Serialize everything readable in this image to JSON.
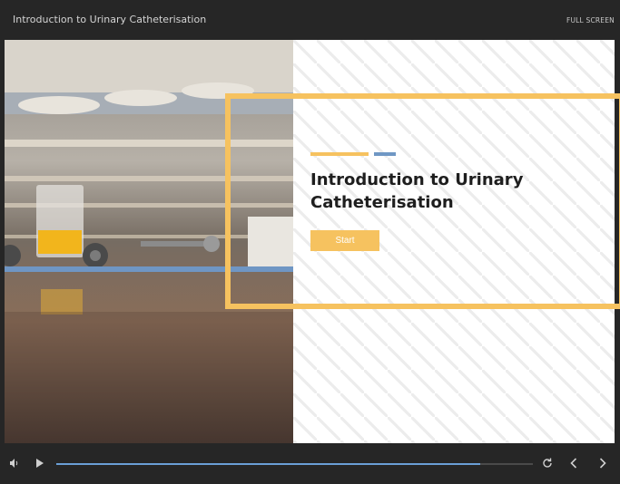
{
  "topbar": {
    "title": "Introduction to Urinary Catheterisation",
    "fullscreen_label": "FULL SCREEN"
  },
  "slide": {
    "heading_line1": "Introduction to Urinary",
    "heading_line2": "Catheterisation",
    "start_label": "Start",
    "colors": {
      "accent": "#f6c25f",
      "secondary_accent": "#6f97c4"
    }
  },
  "player": {
    "icons": {
      "volume": "volume-icon",
      "play": "play-icon",
      "replay": "replay-icon",
      "prev": "chevron-left-icon",
      "next": "chevron-right-icon"
    },
    "progress_percent": 89,
    "progress_color": "#6a9fd6"
  }
}
